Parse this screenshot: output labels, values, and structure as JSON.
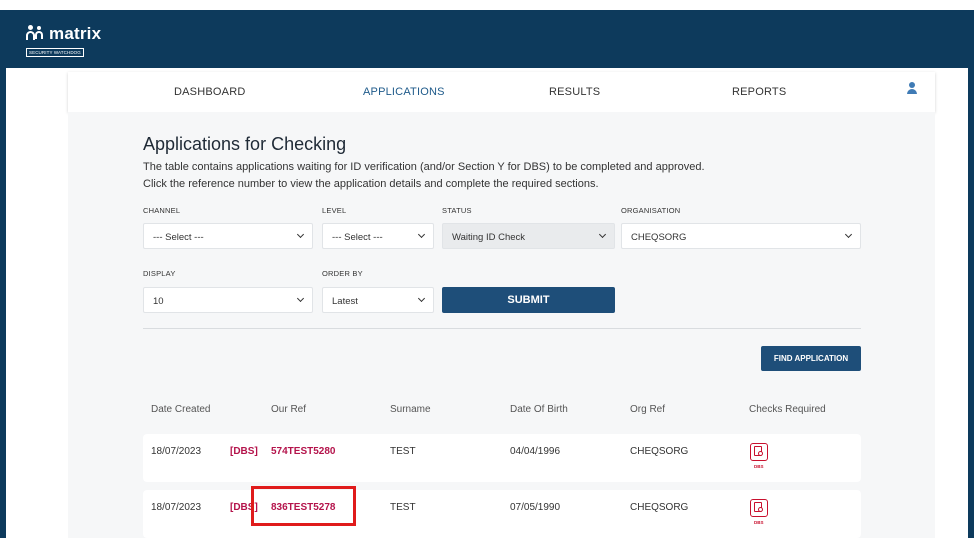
{
  "app": {
    "logo_text": "matrix",
    "logo_tagline": "SECURITY WATCHDOG"
  },
  "nav": {
    "items": [
      {
        "label": "DASHBOARD",
        "active": false
      },
      {
        "label": "APPLICATIONS",
        "active": true
      },
      {
        "label": "RESULTS",
        "active": false
      },
      {
        "label": "REPORTS",
        "active": false
      }
    ],
    "user_icon": "user-icon"
  },
  "page": {
    "title": "Applications for Checking",
    "description_line1": "The table contains applications waiting for ID verification (and/or Section Y for DBS) to be completed and approved.",
    "description_line2": "Click the reference number to view the application details and complete the required sections."
  },
  "filters": {
    "channel": {
      "label": "CHANNEL",
      "value": "--- Select ---"
    },
    "level": {
      "label": "LEVEL",
      "value": "--- Select ---"
    },
    "status": {
      "label": "STATUS",
      "value": "Waiting ID Check"
    },
    "organisation": {
      "label": "ORGANISATION",
      "value": "CHEQSORG"
    },
    "display": {
      "label": "DISPLAY",
      "value": "10"
    },
    "order_by": {
      "label": "ORDER BY",
      "value": "Latest"
    },
    "submit_label": "SUBMIT"
  },
  "find_application_label": "FIND APPLICATION",
  "table": {
    "headers": [
      "Date Created",
      "Our Ref",
      "Surname",
      "Date Of Birth",
      "Org Ref",
      "Checks Required"
    ],
    "rows": [
      {
        "date_created": "18/07/2023",
        "tag": "[DBS]",
        "our_ref": "574TEST5280",
        "surname": "TEST",
        "dob": "04/04/1996",
        "org_ref": "CHEQSORG",
        "check_icon": "dbs-check-icon",
        "check_label": "DBS"
      },
      {
        "date_created": "18/07/2023",
        "tag": "[DBS]",
        "our_ref": "836TEST5278",
        "surname": "TEST",
        "dob": "07/05/1990",
        "org_ref": "CHEQSORG",
        "check_icon": "dbs-check-icon",
        "check_label": "DBS"
      }
    ]
  },
  "colors": {
    "header_bg": "#0d3a5c",
    "button_bg": "#1e4e79",
    "ref_link": "#b4134b",
    "highlight_border": "#e01b1b"
  }
}
